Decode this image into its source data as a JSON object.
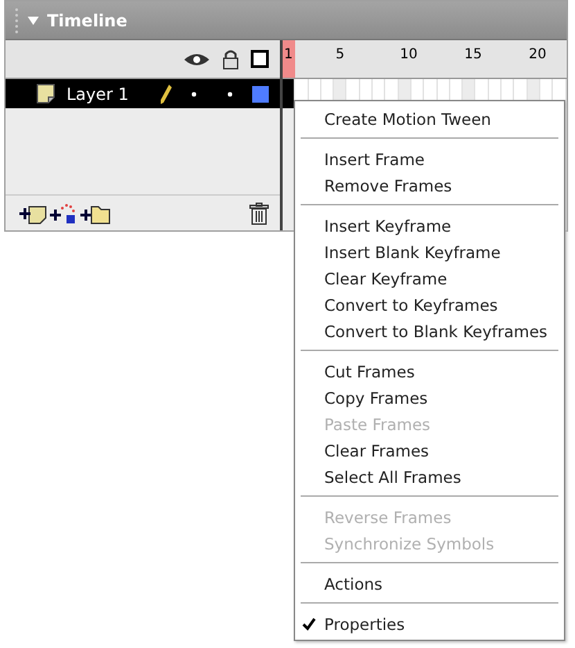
{
  "panel": {
    "title": "Timeline",
    "expanded": true
  },
  "ruler": {
    "labels": [
      "1",
      "5",
      "10",
      "15",
      "20"
    ]
  },
  "layers": [
    {
      "name": "Layer 1",
      "selected": true,
      "color": "#4f7cff"
    }
  ],
  "context_menu": {
    "groups": [
      [
        {
          "label": "Create Motion Tween",
          "disabled": false,
          "checked": false
        }
      ],
      [
        {
          "label": "Insert Frame",
          "disabled": false,
          "checked": false
        },
        {
          "label": "Remove Frames",
          "disabled": false,
          "checked": false
        }
      ],
      [
        {
          "label": "Insert Keyframe",
          "disabled": false,
          "checked": false
        },
        {
          "label": "Insert Blank Keyframe",
          "disabled": false,
          "checked": false
        },
        {
          "label": "Clear Keyframe",
          "disabled": false,
          "checked": false
        },
        {
          "label": "Convert to Keyframes",
          "disabled": false,
          "checked": false
        },
        {
          "label": "Convert to Blank Keyframes",
          "disabled": false,
          "checked": false
        }
      ],
      [
        {
          "label": "Cut Frames",
          "disabled": false,
          "checked": false
        },
        {
          "label": "Copy Frames",
          "disabled": false,
          "checked": false
        },
        {
          "label": "Paste Frames",
          "disabled": true,
          "checked": false
        },
        {
          "label": "Clear Frames",
          "disabled": false,
          "checked": false
        },
        {
          "label": "Select All Frames",
          "disabled": false,
          "checked": false
        }
      ],
      [
        {
          "label": "Reverse Frames",
          "disabled": true,
          "checked": false
        },
        {
          "label": "Synchronize Symbols",
          "disabled": true,
          "checked": false
        }
      ],
      [
        {
          "label": "Actions",
          "disabled": false,
          "checked": false
        }
      ],
      [
        {
          "label": "Properties",
          "disabled": false,
          "checked": true
        }
      ]
    ]
  }
}
